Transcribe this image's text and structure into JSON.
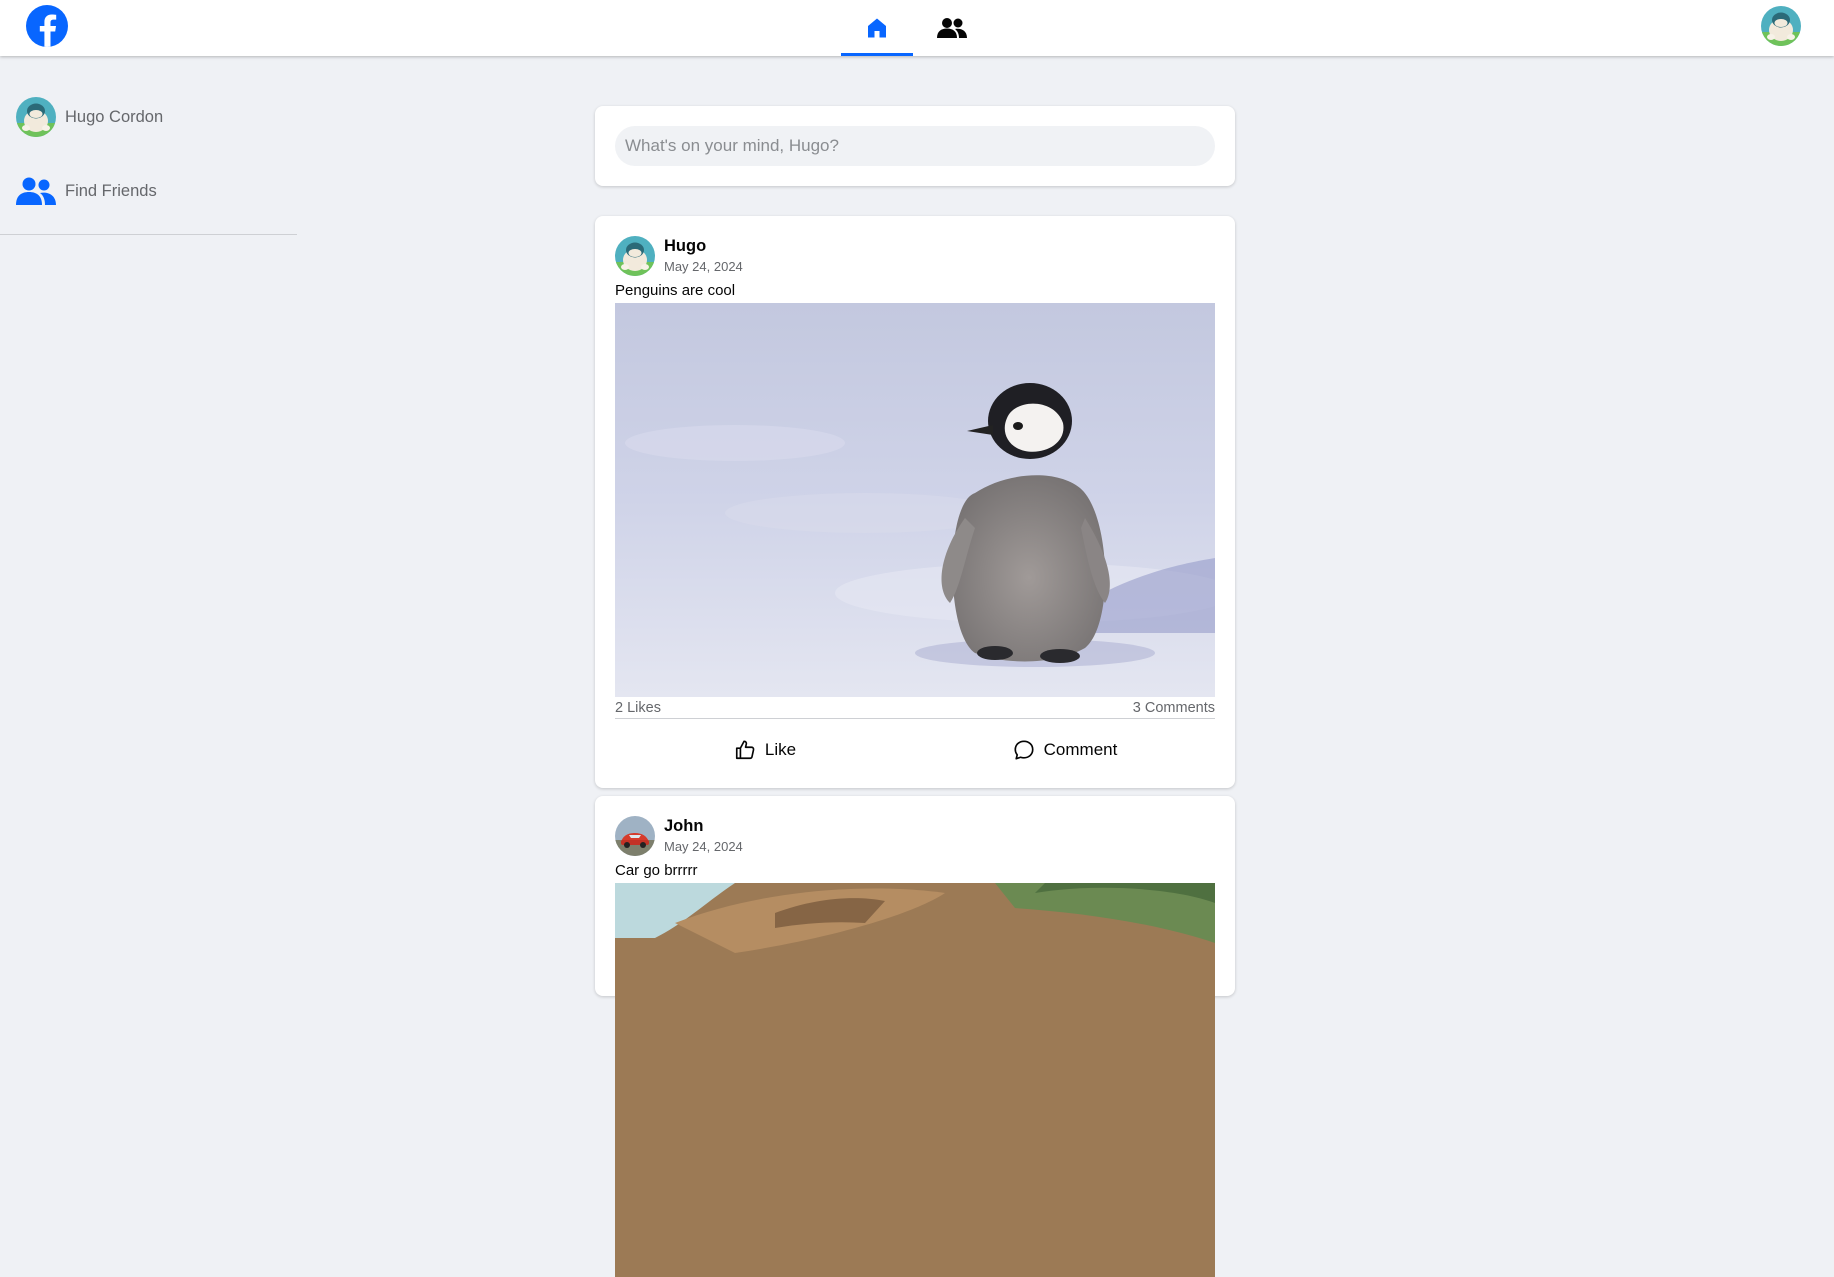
{
  "header": {
    "nav": [
      {
        "id": "home",
        "icon": "home-icon",
        "active": true
      },
      {
        "id": "friends",
        "icon": "friends-icon",
        "active": false
      }
    ]
  },
  "sidebar": {
    "profile_name": "Hugo Cordon",
    "find_friends": "Find Friends"
  },
  "composer": {
    "placeholder": "What's on your mind, Hugo?"
  },
  "posts": [
    {
      "author": "Hugo",
      "date": "May 24, 2024",
      "text": "Penguins are cool",
      "likes": "2 Likes",
      "comments": "3 Comments",
      "like_label": "Like",
      "comment_label": "Comment"
    },
    {
      "author": "John",
      "date": "May 24, 2024",
      "text": "Car go brrrrr"
    }
  ],
  "colors": {
    "accent": "#0866ff",
    "background": "#eff1f5",
    "muted_text": "#65676b"
  }
}
